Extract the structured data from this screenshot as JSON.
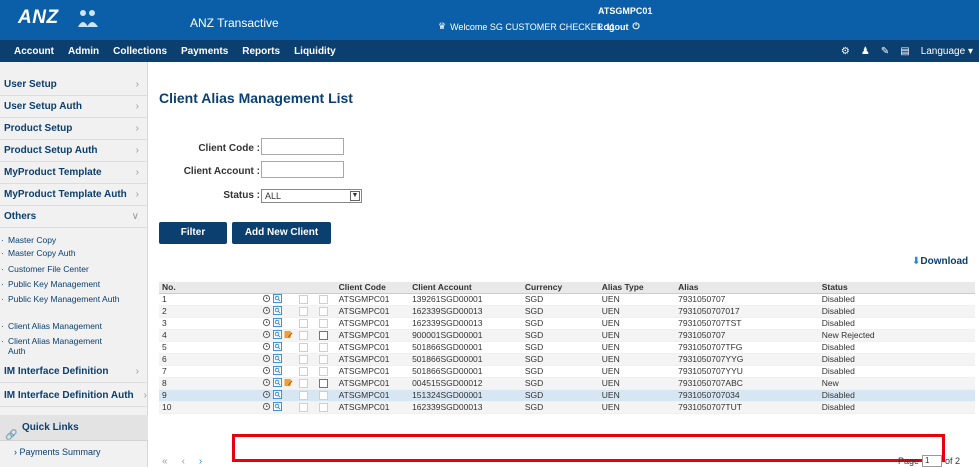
{
  "header": {
    "logo_text": "ANZ",
    "app_title": "ANZ Transactive",
    "user_id": "ATSGMPC01",
    "welcome": "Welcome SG CUSTOMER CHECKER 11",
    "logout": "Logout"
  },
  "menu": {
    "items": [
      "Account",
      "Admin",
      "Collections",
      "Payments",
      "Reports",
      "Liquidity"
    ],
    "language": "Language"
  },
  "sidebar": {
    "items": [
      "User Setup",
      "User Setup Auth",
      "Product Setup",
      "Product Setup Auth",
      "MyProduct Template",
      "MyProduct Template Auth",
      "Others"
    ],
    "sub_items": [
      "Master Copy",
      "Master Copy Auth",
      "Customer File Center",
      "Public Key Management",
      "Public Key Management Auth",
      "Client Alias Management",
      "Client Alias Management Auth"
    ],
    "bottom_items": [
      "IM Interface Definition",
      "IM Interface Definition Auth"
    ],
    "quick_links": "Quick Links",
    "payments_summary": "Payments Summary"
  },
  "page": {
    "title": "Client Alias Management List",
    "client_code_label": "Client Code :",
    "client_account_label": "Client Account :",
    "status_label": "Status :",
    "status_value": "ALL",
    "filter_button": "Filter",
    "add_button": "Add New Client Alias",
    "download": "Download"
  },
  "table": {
    "headers": [
      "No.",
      "",
      "",
      "",
      "Client Code",
      "Client Account",
      "Currency",
      "Alias Type",
      "Alias",
      "Status"
    ],
    "rows": [
      {
        "no": "1",
        "code": "ATSGMPC01",
        "account": "139261SGD00001",
        "currency": "SGD",
        "type": "UEN",
        "alias": "7931050707",
        "status": "Disabled",
        "edit": false,
        "check": false
      },
      {
        "no": "2",
        "code": "ATSGMPC01",
        "account": "162339SGD00013",
        "currency": "SGD",
        "type": "UEN",
        "alias": "7931050707017",
        "status": "Disabled",
        "edit": false,
        "check": false
      },
      {
        "no": "3",
        "code": "ATSGMPC01",
        "account": "162339SGD00013",
        "currency": "SGD",
        "type": "UEN",
        "alias": "7931050707TST",
        "status": "Disabled",
        "edit": false,
        "check": false
      },
      {
        "no": "4",
        "code": "ATSGMPC01",
        "account": "900001SGD00001",
        "currency": "SGD",
        "type": "UEN",
        "alias": "7931050707",
        "status": "New Rejected",
        "edit": true,
        "check": true
      },
      {
        "no": "5",
        "code": "ATSGMPC01",
        "account": "501866SGD00001",
        "currency": "SGD",
        "type": "UEN",
        "alias": "7931050707TFG",
        "status": "Disabled",
        "edit": false,
        "check": false
      },
      {
        "no": "6",
        "code": "ATSGMPC01",
        "account": "501866SGD00001",
        "currency": "SGD",
        "type": "UEN",
        "alias": "7931050707YYG",
        "status": "Disabled",
        "edit": false,
        "check": false
      },
      {
        "no": "7",
        "code": "ATSGMPC01",
        "account": "501866SGD00001",
        "currency": "SGD",
        "type": "UEN",
        "alias": "7931050707YYU",
        "status": "Disabled",
        "edit": false,
        "check": false
      },
      {
        "no": "8",
        "code": "ATSGMPC01",
        "account": "004515SGD00012",
        "currency": "SGD",
        "type": "UEN",
        "alias": "7931050707ABC",
        "status": "New",
        "edit": true,
        "check": true
      },
      {
        "no": "9",
        "code": "ATSGMPC01",
        "account": "151324SGD00001",
        "currency": "SGD",
        "type": "UEN",
        "alias": "7931050707034",
        "status": "Disabled",
        "edit": false,
        "check": false
      },
      {
        "no": "10",
        "code": "ATSGMPC01",
        "account": "162339SGD00013",
        "currency": "SGD",
        "type": "UEN",
        "alias": "7931050707TUT",
        "status": "Disabled",
        "edit": false,
        "check": false
      }
    ]
  },
  "pager": {
    "page_label": "Page",
    "page_value": "1",
    "of": "of 2"
  },
  "colors": {
    "header_blue": "#0a5fa8",
    "nav_dark": "#0b3f70",
    "highlight_red": "#e8000c"
  }
}
